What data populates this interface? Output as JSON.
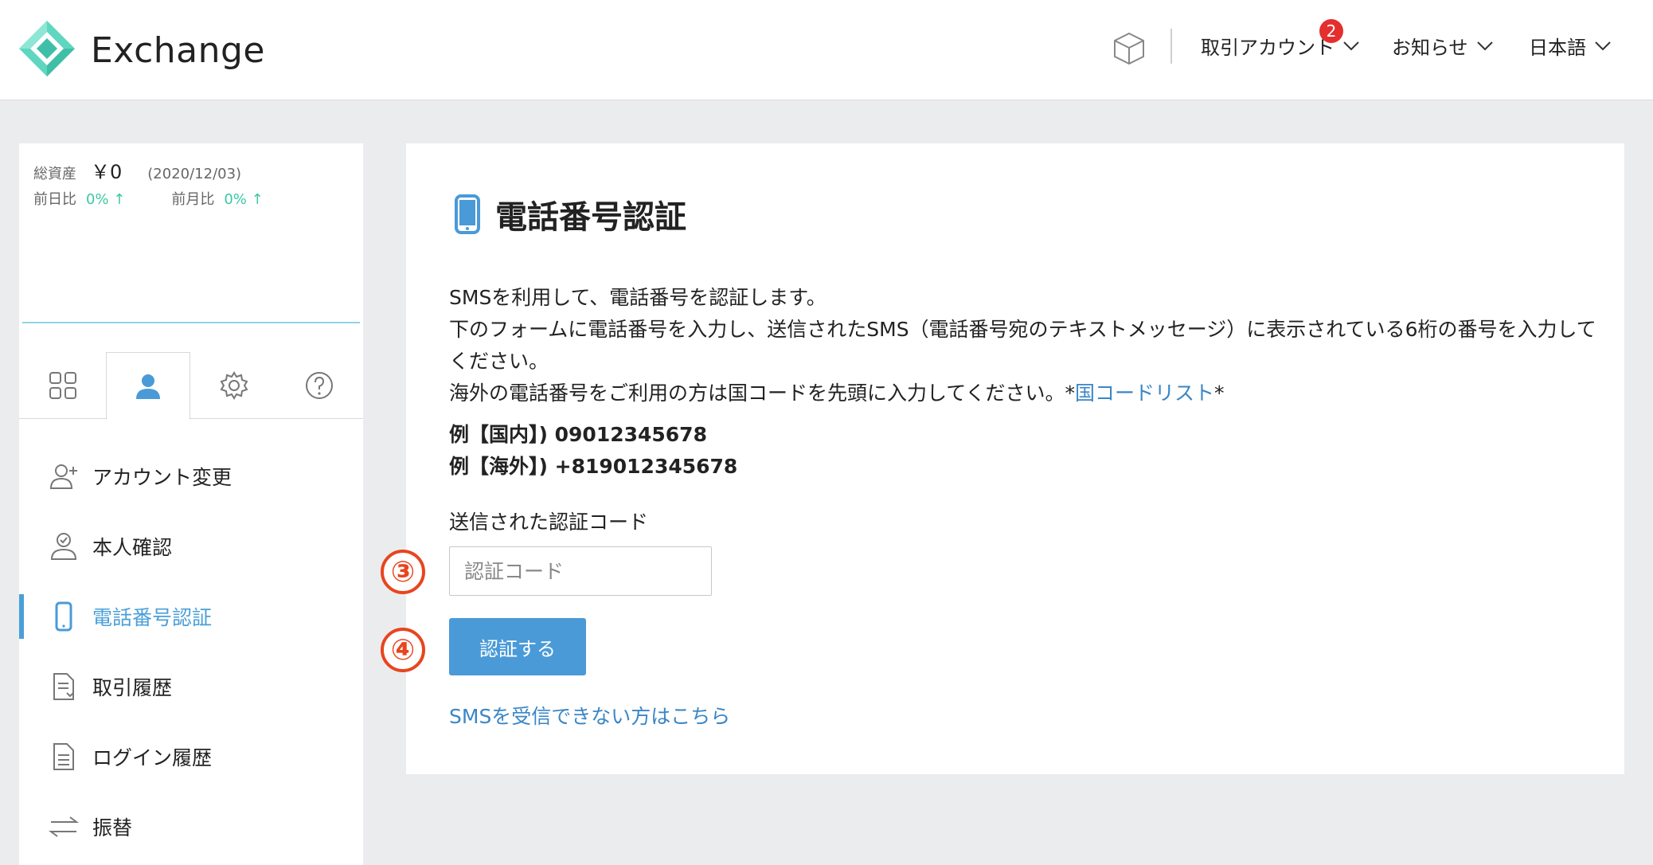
{
  "header": {
    "brand": "Exchange",
    "nav": [
      {
        "label": "取引アカウント",
        "badge": "2"
      },
      {
        "label": "お知らせ"
      },
      {
        "label": "日本語"
      }
    ]
  },
  "sidebar": {
    "assets": {
      "total_label": "総資産",
      "total_value": "￥0",
      "date": "(2020/12/03)",
      "day_label": "前日比",
      "day_value": "0% ↑",
      "month_label": "前月比",
      "month_value": "0% ↑"
    },
    "tabs": [
      "grid-icon",
      "user-icon",
      "gear-icon",
      "help-icon"
    ],
    "menu": [
      {
        "label": "アカウント変更",
        "icon": "user-add-icon"
      },
      {
        "label": "本人確認",
        "icon": "user-check-icon"
      },
      {
        "label": "電話番号認証",
        "icon": "phone-icon",
        "active": true
      },
      {
        "label": "取引履歴",
        "icon": "document-download-icon"
      },
      {
        "label": "ログイン履歴",
        "icon": "document-icon"
      },
      {
        "label": "振替",
        "icon": "transfer-icon"
      }
    ]
  },
  "main": {
    "title": "電話番号認証",
    "desc_line1": "SMSを利用して、電話番号を認証します。",
    "desc_line2": "下のフォームに電話番号を入力し、送信されたSMS（電話番号宛のテキストメッセージ）に表示されている6桁の番号を入力してください。",
    "desc_line3_pre": "海外の電話番号をご利用の方は国コードを先頭に入力してください。*",
    "desc_line3_link": "国コードリスト",
    "desc_line3_post": "*",
    "example_domestic": "例【国内】) 09012345678",
    "example_overseas": "例【海外】) +819012345678",
    "code_label": "送信された認証コード",
    "code_placeholder": "認証コード",
    "code_value": "",
    "verify_button": "認証する",
    "help_link": "SMSを受信できない方はこちら"
  },
  "annotations": {
    "step3": "③",
    "step4": "④"
  },
  "colors": {
    "accent": "#4a9ad8",
    "link": "#3a86c6",
    "positive": "#3cc7a3",
    "badge": "#e52e2e",
    "annotation": "#e8451e"
  }
}
